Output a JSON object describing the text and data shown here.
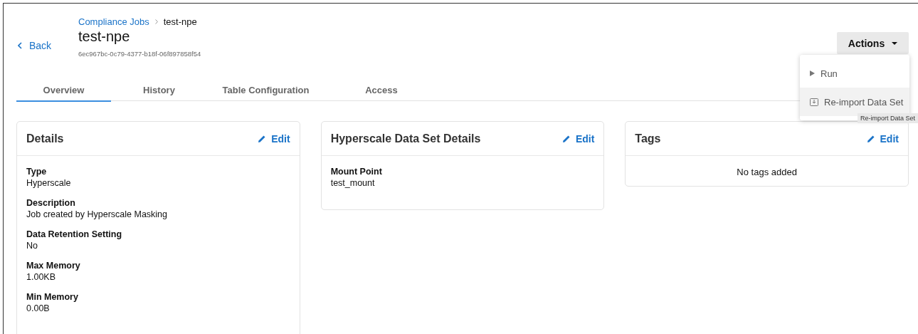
{
  "header": {
    "back": "Back",
    "breadcrumb": [
      {
        "label": "Compliance Jobs",
        "kind": "link"
      },
      {
        "label": "test-npe",
        "kind": "current"
      }
    ],
    "title": "test-npe",
    "id": "6ec967bc-0c79-4377-b18f-06f897858f54"
  },
  "tabs": [
    {
      "label": "Overview",
      "selected": true
    },
    {
      "label": "History",
      "selected": false
    },
    {
      "label": "Table Configuration",
      "selected": false
    },
    {
      "label": "Access",
      "selected": false
    }
  ],
  "actions": {
    "label": "Actions",
    "expanded": true,
    "items": [
      {
        "label": "Run",
        "kind": "run",
        "selected": false
      },
      {
        "label": "Re-import Data Set",
        "kind": "import",
        "selected": true
      }
    ],
    "tooltip": "Re-import Data Set"
  },
  "cards": [
    {
      "kind": "fields",
      "title": "Details",
      "edit": "Edit",
      "fields": [
        {
          "label": "Type",
          "value": "Hyperscale"
        },
        {
          "label": "Description",
          "value": "Job created by Hyperscale Masking"
        },
        {
          "label": "Data Retention Setting",
          "value": "No"
        },
        {
          "label": "Max Memory",
          "value": "1.00KB"
        },
        {
          "label": "Min Memory",
          "value": "0.00B"
        }
      ]
    },
    {
      "kind": "fields",
      "title": "Hyperscale Data Set Details",
      "edit": "Edit",
      "fields": [
        {
          "label": "Mount Point",
          "value": "test_mount"
        }
      ]
    },
    {
      "kind": "empty",
      "title": "Tags",
      "edit": "Edit",
      "message": "No tags added"
    }
  ]
}
